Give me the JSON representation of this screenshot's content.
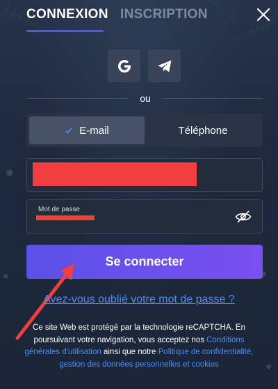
{
  "tabs": {
    "login": "CONNEXION",
    "register": "INSCRIPTION"
  },
  "social": {
    "google_icon": "google-g-icon",
    "telegram_icon": "telegram-plane-icon"
  },
  "separator": {
    "text": "ou"
  },
  "method_toggle": {
    "email": "E-mail",
    "phone": "Téléphone",
    "selected": "email"
  },
  "form": {
    "email": {
      "value": "",
      "placeholder": ""
    },
    "password": {
      "label": "Mot de passe",
      "value": "",
      "placeholder": ""
    },
    "submit_label": "Se connecter",
    "forgot_link": "Avez-vous oublié votre mot de passe ?"
  },
  "legal": {
    "text_1": "Ce site Web est protégé par la technologie reCAPTCHA. En poursuivant votre navigation, vous acceptez nos",
    "link_terms": "Conditions générales d'utilisation",
    "text_2": "ainsi que notre",
    "link_privacy": "Politique de confidentialité, gestion des données personnelles et cookies"
  },
  "colors": {
    "background": "#1f2a3f",
    "accent": "#5a55e6",
    "button_gradient_start": "#5a50e8",
    "button_gradient_end": "#7a4ff0",
    "link": "#4e8df0",
    "annotation": "#f13f3f"
  }
}
